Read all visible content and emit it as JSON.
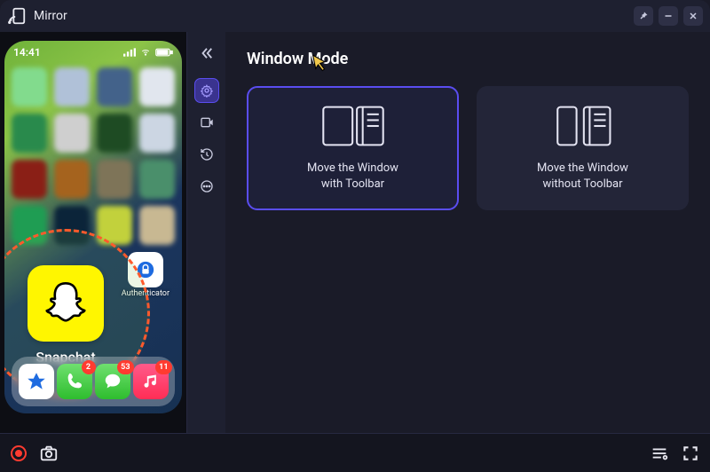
{
  "app": {
    "title": "Mirror"
  },
  "panel": {
    "heading": "Window Mode",
    "options": [
      {
        "line1": "Move the Window",
        "line2": "with Toolbar"
      },
      {
        "line1": "Move the Window",
        "line2": "without Toolbar"
      }
    ]
  },
  "phone": {
    "time": "14:41",
    "snapchat_label": "Snapchat",
    "auth_label": "Authenticator",
    "dock_badges": {
      "phone": "2",
      "messages": "53",
      "music": "11"
    }
  }
}
